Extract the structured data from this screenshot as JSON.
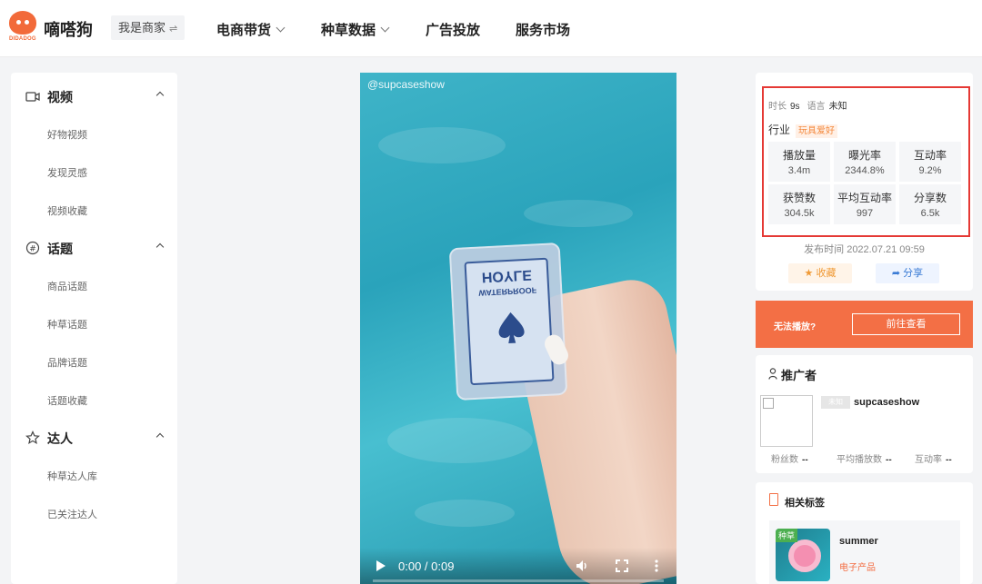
{
  "header": {
    "logo_sub": "DIDADOG",
    "brand": "嘀嗒狗",
    "merchant_label": "我是商家",
    "merchant_icon": "⇌",
    "nav": [
      "电商带货",
      "种草数据",
      "广告投放",
      "服务市场"
    ]
  },
  "sidebar": {
    "sections": [
      {
        "label": "视频",
        "items": [
          "好物视频",
          "发现灵感",
          "视频收藏"
        ]
      },
      {
        "label": "话题",
        "items": [
          "商品话题",
          "种草话题",
          "品牌话题",
          "话题收藏"
        ]
      },
      {
        "label": "达人",
        "items": [
          "种草达人库",
          "已关注达人"
        ]
      }
    ]
  },
  "video": {
    "handle": "@supcaseshow",
    "card_brand": "HOYLE",
    "card_sub": "WATERPROOF",
    "time": "0:00 / 0:09"
  },
  "stats": {
    "duration_label": "时长",
    "duration": "9s",
    "language_label": "语言",
    "language": "未知",
    "industry_label": "行业",
    "industry_tag": "玩具爱好",
    "metrics": [
      {
        "k": "播放量",
        "v": "3.4m"
      },
      {
        "k": "曝光率",
        "v": "2344.8%"
      },
      {
        "k": "互动率",
        "v": "9.2%"
      },
      {
        "k": "获赞数",
        "v": "304.5k"
      },
      {
        "k": "平均互动率",
        "v": "997"
      },
      {
        "k": "分享数",
        "v": "6.5k"
      }
    ],
    "published": "发布时间 2022.07.21 09:59",
    "fav_label": "收藏",
    "share_label": "分享"
  },
  "banner": {
    "question": "无法播放?",
    "go_label": "前往查看"
  },
  "promoter": {
    "title": "推广者",
    "badge": "未知",
    "name": "supcaseshow",
    "stats": [
      {
        "k": "粉丝数",
        "v": "--"
      },
      {
        "k": "平均播放数",
        "v": "--"
      },
      {
        "k": "互动率",
        "v": "--"
      }
    ]
  },
  "related": {
    "title": "相关标签",
    "thumb_label": "种草",
    "tag_name": "summer",
    "tag_category": "电子产品"
  },
  "colors": {
    "accent": "#f36f45",
    "highlight_border": "#e53935"
  }
}
